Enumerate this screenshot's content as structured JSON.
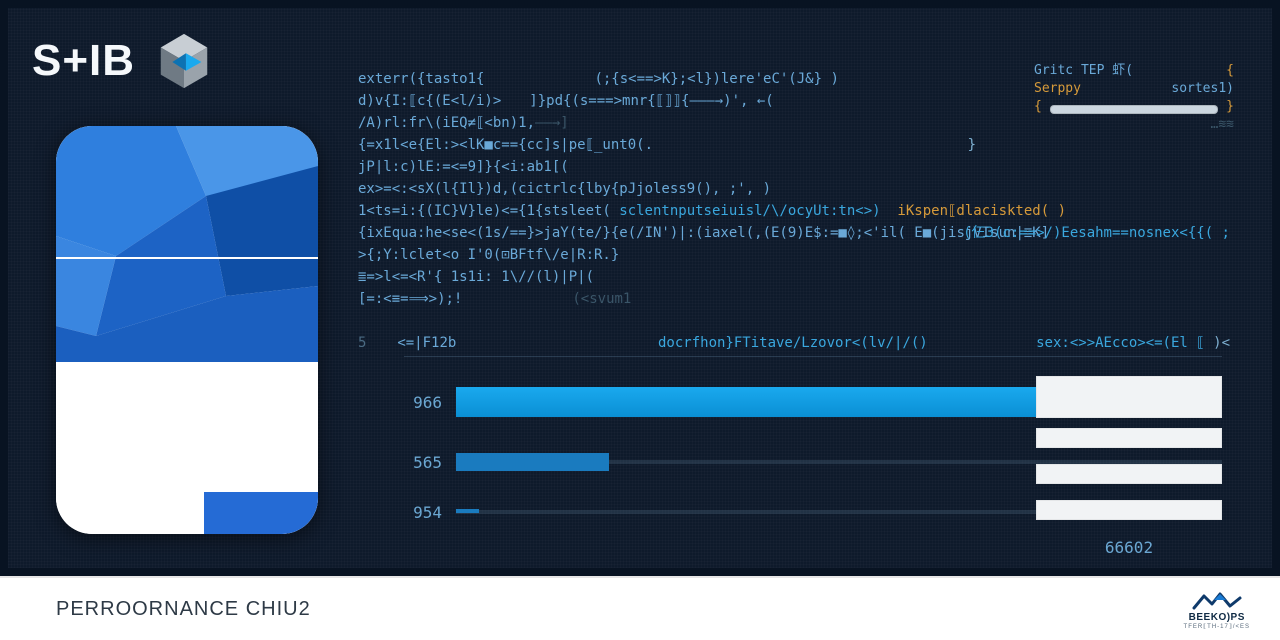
{
  "brand": {
    "text": "S+IB"
  },
  "side_note": {
    "line1_left": "Gritc TEP 虾(",
    "line1_right": "{",
    "line2_left": "Serppy",
    "line2_right": "sortes1)",
    "brace_open": "{"
  },
  "code": {
    "lines": [
      {
        "gutter": "",
        "left": "exterr({tasto1{",
        "mid": "(;{s<==>K};<l})lere'eC'(J&} )",
        "right": ""
      },
      {
        "gutter": "",
        "left": "  d)v{I:⟦c{(E<l/i)>",
        "mid": "]}pd{(s===>mnr{⟦⟧⟧{———→)', ←(",
        "right": ""
      },
      {
        "gutter": "",
        "left": "   /A)rl:fr\\(iEQ≠⟦<bn)1,",
        "mid": "——→]",
        "right": ""
      },
      {
        "gutter": "",
        "left": " {=x1l<e{El:><lK■c=={cc]s|pe⟦_unt0(.",
        "mid": "}",
        "right": ""
      },
      {
        "gutter": "",
        "left": "jP|l:c)lE:=<=9]}{<i:ab1[(",
        "mid": "",
        "right": ""
      },
      {
        "gutter": "",
        "left": "  ex>=<:<sX(l{Il})d,(cictrlc{lby{pJjoless9(), ;', )",
        "mid": "",
        "right": ""
      },
      {
        "gutter": "",
        "left": "1<ts=i:{(IC}V}le)<={1{stsleet(",
        "mid": "}",
        "right_a": "sclentnputseiuisl/\\/ocyUt:tn<>)",
        "right_b": "iKspen⟦dlaciskted( )"
      },
      {
        "gutter": "",
        "left": "  {ixEqua:he<se<(1s/==}>jaY(te/}{e(/IN')|:(iaxel(,(E(9)E$:=■◊;<'il( E■(jisjVIsun|≣K]",
        "mid": "",
        "right_a": "(仨3(⁠c:==>/)Eesahm==nosnex<{{( ;"
      },
      {
        "gutter": "",
        "left": "    >{;Y:lclet<o  I'0(⊡BFtf\\/e|R:R.}",
        "mid": "",
        "right": ""
      },
      {
        "gutter": "",
        "left": "      ≣=>l<=<R'{ 1s1i:  1\\//(l)|P|(",
        "mid": "",
        "right": ""
      },
      {
        "gutter": "",
        "left": "    [=:<≡=⟹>);!",
        "mid": "(<svum1",
        "right": ""
      },
      {
        "gutter": "",
        "left": "",
        "mid": "",
        "right": ""
      },
      {
        "gutter": "5",
        "left": "<=|F12b",
        "mid": "docrfhon}FTitave/Lzovor<(lv/|/()",
        "right_a": "sex:<>>AEcco><=(El ⟦",
        "right_b": ")<"
      }
    ]
  },
  "chart_data": {
    "type": "bar",
    "orientation": "horizontal",
    "categories": [
      "966",
      "565",
      "954"
    ],
    "values": [
      585,
      120,
      18
    ],
    "xmax": 600,
    "legend_caption": "66602",
    "legend_boxes": 4
  },
  "footer": {
    "title": "PERROORNANCE CHIU2",
    "logo_text": "BEEKO)PS",
    "logo_sub": "TFER⟦TH-17⟧/<ES"
  }
}
